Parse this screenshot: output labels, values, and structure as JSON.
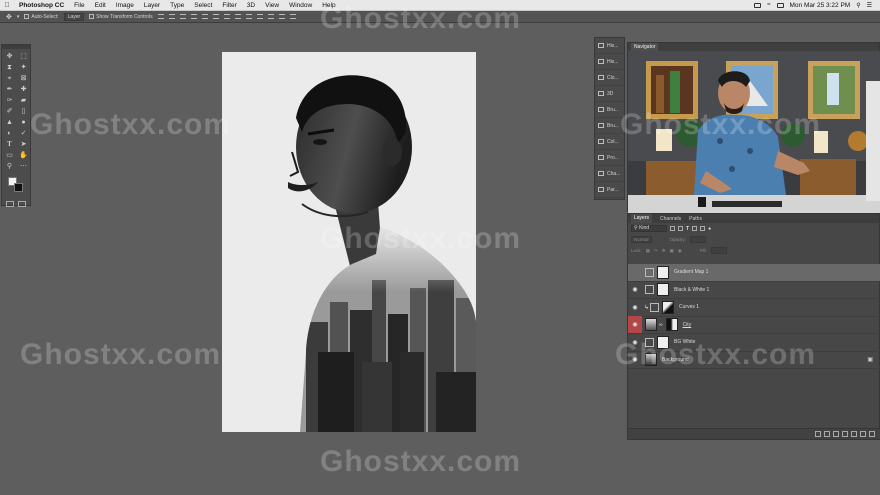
{
  "menubar": {
    "app": "Photoshop CC",
    "items": [
      "File",
      "Edit",
      "Image",
      "Layer",
      "Type",
      "Select",
      "Filter",
      "3D",
      "View",
      "Window",
      "Help"
    ],
    "clock": "Mon Mar 25  3:22 PM"
  },
  "options": {
    "auto_select_label": "Auto-Select:",
    "auto_select_value": "Layer",
    "transform_label": "Show Transform Controls"
  },
  "panels": {
    "strip": [
      "His...",
      "His...",
      "Clo...",
      "3D",
      "Bru...",
      "Bru...",
      "Col...",
      "Pro...",
      "Cha...",
      "Par..."
    ]
  },
  "navigator": {
    "tab": "Navigator"
  },
  "layers": {
    "tabs": [
      "Layers",
      "Channels",
      "Paths"
    ],
    "filter_kind": "Kind",
    "blend_mode": "Normal",
    "opacity_label": "Opacity:",
    "lock_label": "Lock:",
    "fill_label": "Fill:",
    "items": [
      {
        "name": "Gradient Map 1",
        "visible": false,
        "selected": true,
        "thumb": "#f0f0f0"
      },
      {
        "name": "Black & White 1",
        "visible": true,
        "selected": false,
        "thumb": "#f0f0f0"
      },
      {
        "name": "Curves 1",
        "visible": true,
        "selected": false,
        "thumb": "#222222"
      },
      {
        "name": "City",
        "visible": true,
        "selected": false,
        "thumb": "#777777"
      },
      {
        "name": "BG White",
        "visible": true,
        "selected": false,
        "thumb": "#f0f0f0"
      },
      {
        "name": "Background",
        "visible": true,
        "selected": false,
        "thumb": "#555555"
      }
    ]
  },
  "colors": {
    "fg": "#f2f2f2",
    "bg": "#111111",
    "red_eye": "#b34747"
  },
  "watermark": "Ghostxx.com"
}
